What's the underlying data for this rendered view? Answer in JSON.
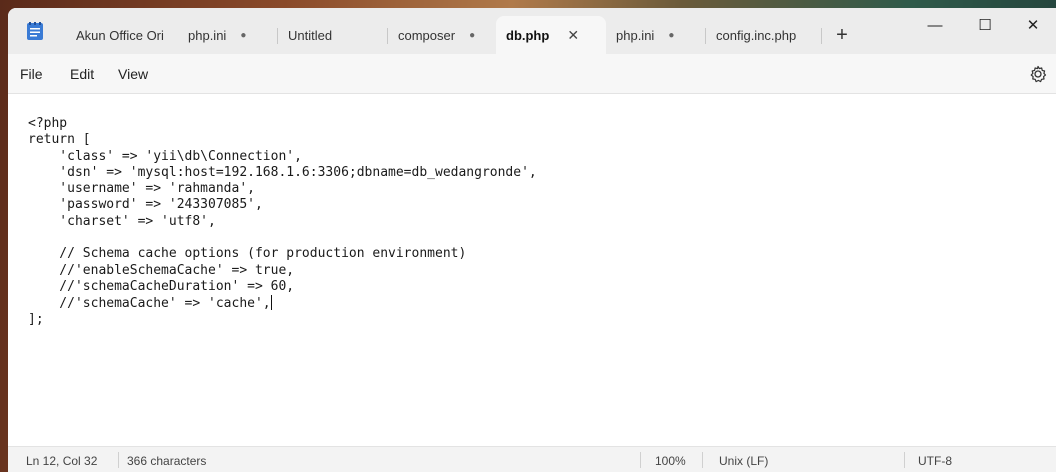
{
  "tabs": [
    {
      "label": "Akun Office Ori",
      "modified": false,
      "active": false
    },
    {
      "label": "php.ini",
      "modified": true,
      "modified_glyph": "●",
      "active": false
    },
    {
      "label": "Untitled",
      "modified": false,
      "active": false
    },
    {
      "label": "composer",
      "modified": true,
      "modified_glyph": "●",
      "active": false
    },
    {
      "label": "db.php",
      "modified": false,
      "active": true,
      "close_glyph": "✕"
    },
    {
      "label": "php.ini",
      "modified": true,
      "modified_glyph": "●",
      "active": false
    },
    {
      "label": "config.inc.php",
      "modified": false,
      "active": false
    }
  ],
  "add_tab_glyph": "+",
  "window_controls": {
    "minimize": "—",
    "maximize": "☐",
    "close": "✕"
  },
  "menu": {
    "file": "File",
    "edit": "Edit",
    "view": "View"
  },
  "icons": {
    "app": "notepad-icon",
    "settings": "gear-icon"
  },
  "editor": {
    "lines": [
      "<?php",
      "return [",
      "    'class' => 'yii\\db\\Connection',",
      "    'dsn' => 'mysql:host=192.168.1.6:3306;dbname=db_wedangronde',",
      "    'username' => 'rahmanda',",
      "    'password' => '243307085',",
      "    'charset' => 'utf8',",
      "",
      "    // Schema cache options (for production environment)",
      "    //'enableSchemaCache' => true,",
      "    //'schemaCacheDuration' => 60,",
      "    //'schemaCache' => 'cache',",
      "];"
    ],
    "caret_line": 12
  },
  "status": {
    "position": "Ln 12, Col 32",
    "characters": "366 characters",
    "zoom": "100%",
    "line_ending": "Unix (LF)",
    "encoding": "UTF-8"
  },
  "colors": {
    "accent": "#f7f7f7",
    "titlebar": "#ececec"
  }
}
